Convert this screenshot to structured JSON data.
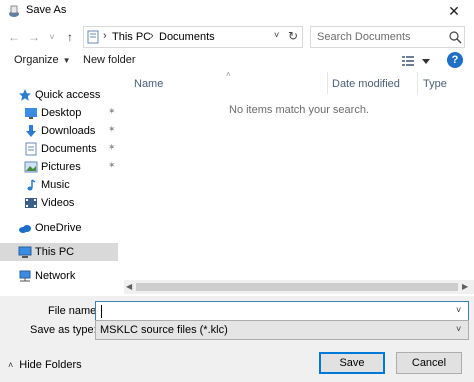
{
  "window": {
    "title": "Save As",
    "close_glyph": "✕"
  },
  "nav": {
    "back_glyph": "←",
    "forward_glyph": "→",
    "recent_glyph": "˅",
    "up_glyph": "↑",
    "breadcrumb": [
      "This PC",
      "Documents"
    ],
    "crumb_separator": "›",
    "dropdown_glyph": "˅",
    "refresh_glyph": "↻",
    "search_placeholder": "Search Documents"
  },
  "toolbar": {
    "organize_label": "Organize",
    "organize_caret": "▼",
    "new_folder_label": "New folder",
    "help_label": "?"
  },
  "sidebar": {
    "items": [
      {
        "label": "Quick access",
        "icon": "star-icon",
        "pinned": false
      },
      {
        "label": "Desktop",
        "icon": "desktop-icon",
        "pinned": true
      },
      {
        "label": "Downloads",
        "icon": "download-icon",
        "pinned": true
      },
      {
        "label": "Documents",
        "icon": "documents-icon",
        "pinned": true
      },
      {
        "label": "Pictures",
        "icon": "pictures-icon",
        "pinned": true
      },
      {
        "label": "Music",
        "icon": "music-icon",
        "pinned": false
      },
      {
        "label": "Videos",
        "icon": "videos-icon",
        "pinned": false
      },
      {
        "label": "OneDrive",
        "icon": "cloud-icon",
        "pinned": false
      },
      {
        "label": "This PC",
        "icon": "pc-icon",
        "pinned": false,
        "selected": true
      },
      {
        "label": "Network",
        "icon": "network-icon",
        "pinned": false
      }
    ],
    "pin_glyph": "✶"
  },
  "content": {
    "columns": [
      "Name",
      "Date modified",
      "Type"
    ],
    "sort_glyph": "˄",
    "empty_message": "No items match your search."
  },
  "save": {
    "file_name_label": "File name:",
    "file_name_value": "",
    "save_as_type_label": "Save as type:",
    "save_as_type_value": "MSKLC source files (*.klc)",
    "dropdown_glyph": "˅",
    "hide_folders_label": "Hide Folders",
    "hide_folders_glyph": "˄",
    "save_button": "Save",
    "cancel_button": "Cancel"
  },
  "scroll": {
    "left_glyph": "◀",
    "right_glyph": "▶"
  },
  "colors": {
    "accent": "#0078d7",
    "selected_bg": "#d9d9d9",
    "panel_bg": "#f0f0f0"
  }
}
